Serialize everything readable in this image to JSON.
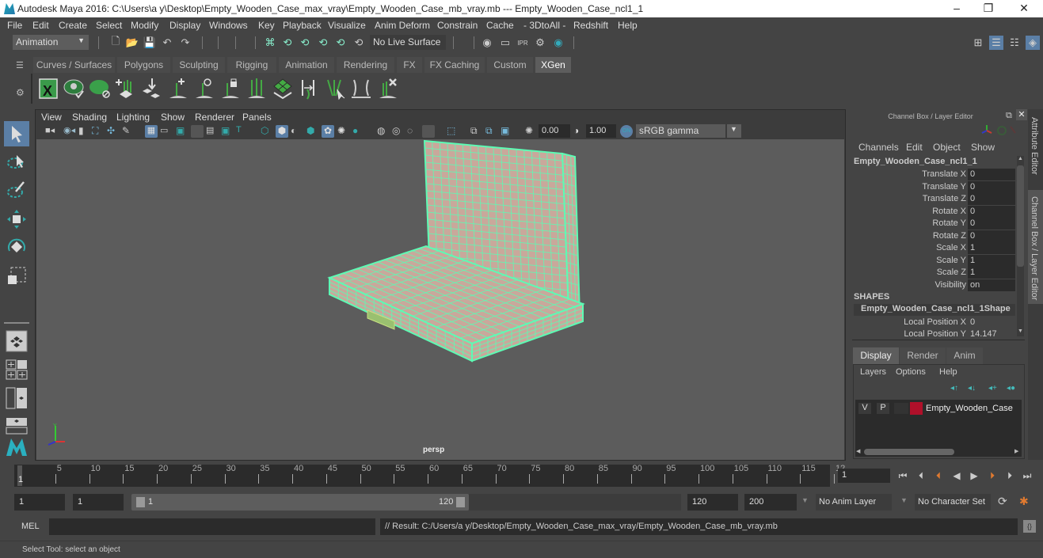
{
  "window": {
    "title": "Autodesk Maya 2016: C:\\Users\\a y\\Desktop\\Empty_Wooden_Case_max_vray\\Empty_Wooden_Case_mb_vray.mb   ---   Empty_Wooden_Case_ncl1_1",
    "controls": {
      "minimize": "–",
      "maximize": "❐",
      "close": "✕"
    }
  },
  "menubar": [
    "File",
    "Edit",
    "Create",
    "Select",
    "Modify",
    "Display",
    "Windows",
    "Key",
    "Playback",
    "Visualize",
    "Anim Deform",
    "Constrain",
    "Cache",
    "- 3DtoAll -",
    "Redshift",
    "Help"
  ],
  "statusline": {
    "mode": "Animation",
    "live_surface": "No Live Surface"
  },
  "shelf": {
    "tabs": [
      "Curves / Surfaces",
      "Polygons",
      "Sculpting",
      "Rigging",
      "Animation",
      "Rendering",
      "FX",
      "FX Caching",
      "Custom",
      "XGen"
    ],
    "active_tab": "XGen",
    "icons": [
      "xgen-editor-icon",
      "xgen-preview-icon",
      "xgen-clear-preview-icon",
      "add-guides-icon",
      "place-guides-icon",
      "add-guide-icon",
      "select-guide-icon",
      "lock-guide-icon",
      "guides-to-curves-icon",
      "xgen-patch-icon",
      "rebuild-guides-icon",
      "bend-guides-icon",
      "guide-select-icon",
      "delete-guide-icon"
    ]
  },
  "viewport": {
    "menu": [
      "View",
      "Shading",
      "Lighting",
      "Show",
      "Renderer",
      "Panels"
    ],
    "exposure": "0.00",
    "gamma": "1.00",
    "color_space": "sRGB gamma",
    "camera_label": "persp",
    "wire_color": "#5dfbb4",
    "face_color": "#c9a89b"
  },
  "channelbox": {
    "header": "Channel Box / Layer Editor",
    "menu": [
      "Channels",
      "Edit",
      "Object",
      "Show"
    ],
    "object_name": "Empty_Wooden_Case_ncl1_1",
    "channels": [
      {
        "label": "Translate X",
        "value": "0"
      },
      {
        "label": "Translate Y",
        "value": "0"
      },
      {
        "label": "Translate Z",
        "value": "0"
      },
      {
        "label": "Rotate X",
        "value": "0"
      },
      {
        "label": "Rotate Y",
        "value": "0"
      },
      {
        "label": "Rotate Z",
        "value": "0"
      },
      {
        "label": "Scale X",
        "value": "1"
      },
      {
        "label": "Scale Y",
        "value": "1"
      },
      {
        "label": "Scale Z",
        "value": "1"
      },
      {
        "label": "Visibility",
        "value": "on"
      }
    ],
    "shapes_header": "SHAPES",
    "shape_name": "Empty_Wooden_Case_ncl1_1Shape",
    "shape_channels": [
      {
        "label": "Local Position X",
        "value": "0"
      },
      {
        "label": "Local Position Y",
        "value": "14.147"
      }
    ]
  },
  "layer_editor": {
    "tabs": [
      "Display",
      "Render",
      "Anim"
    ],
    "active_tab": "Display",
    "menu": [
      "Layers",
      "Options",
      "Help"
    ],
    "layers": [
      {
        "v": "V",
        "p": "P",
        "color": "#b0102a",
        "name": "Empty_Wooden_Case"
      }
    ]
  },
  "side_tabs": [
    "Attribute Editor",
    "Channel Box / Layer Editor"
  ],
  "timeline": {
    "ticks": [
      "5",
      "10",
      "15",
      "20",
      "25",
      "30",
      "35",
      "40",
      "45",
      "50",
      "55",
      "60",
      "65",
      "70",
      "75",
      "80",
      "85",
      "90",
      "95",
      "100",
      "105",
      "110",
      "115",
      "12"
    ],
    "current_frame_marker": "1",
    "current_frame": "1"
  },
  "range": {
    "start": "1",
    "playback_start": "1",
    "slider_start": "1",
    "slider_end": "120",
    "playback_end": "120",
    "end": "200",
    "anim_layer": "No Anim Layer",
    "character_set": "No Character Set"
  },
  "command": {
    "lang": "MEL",
    "input": "",
    "result": "// Result: C:/Users/a y/Desktop/Empty_Wooden_Case_max_vray/Empty_Wooden_Case_mb_vray.mb"
  },
  "help_line": "Select Tool: select an object"
}
